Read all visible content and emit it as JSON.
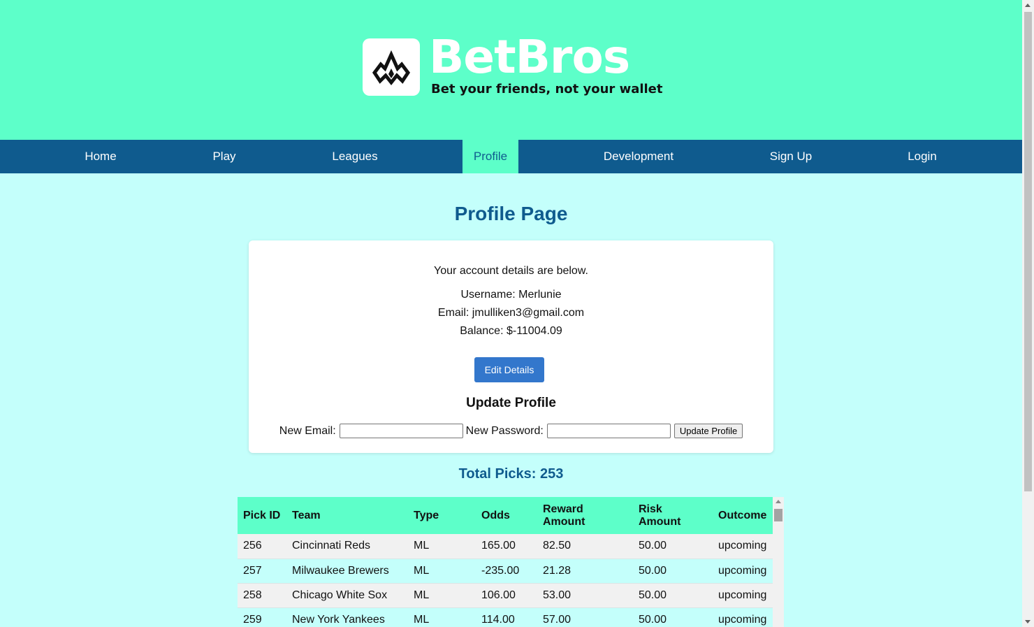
{
  "brand": {
    "name": "BetBros",
    "tagline": "Bet your friends, not your wallet",
    "logo_icon": "crown-flame-icon"
  },
  "colors": {
    "header_bg": "#5dffc9",
    "nav_bg": "#0f5b8e",
    "page_bg": "#c4fffb",
    "accent_text": "#0f5b8e",
    "button_blue": "#3377cc"
  },
  "nav": {
    "items": [
      {
        "label": "Home"
      },
      {
        "label": "Play"
      },
      {
        "label": "Leagues"
      },
      {
        "label": "Profile",
        "active": true
      },
      {
        "label": "Development"
      },
      {
        "label": "Sign Up"
      },
      {
        "label": "Login"
      }
    ]
  },
  "page": {
    "title": "Profile Page"
  },
  "account": {
    "intro": "Your account details are below.",
    "username": "Username: Merlunie",
    "email": "Email: jmulliken3@gmail.com",
    "balance": "Balance: $-11004.09",
    "edit_button": "Edit Details"
  },
  "update_form": {
    "heading": "Update Profile",
    "email_label": "New Email:",
    "email_value": "",
    "password_label": "New Password:",
    "password_value": "",
    "submit_label": "Update Profile"
  },
  "picks": {
    "total_label": "Total Picks: 253",
    "columns": [
      "Pick ID",
      "Team",
      "Type",
      "Odds",
      "Reward Amount",
      "Risk Amount",
      "Outcome"
    ],
    "rows": [
      [
        "256",
        "Cincinnati Reds",
        "ML",
        "165.00",
        "82.50",
        "50.00",
        "upcoming"
      ],
      [
        "257",
        "Milwaukee Brewers",
        "ML",
        "-235.00",
        "21.28",
        "50.00",
        "upcoming"
      ],
      [
        "258",
        "Chicago White Sox",
        "ML",
        "106.00",
        "53.00",
        "50.00",
        "upcoming"
      ],
      [
        "259",
        "New York Yankees",
        "ML",
        "114.00",
        "57.00",
        "50.00",
        "upcoming"
      ]
    ]
  }
}
